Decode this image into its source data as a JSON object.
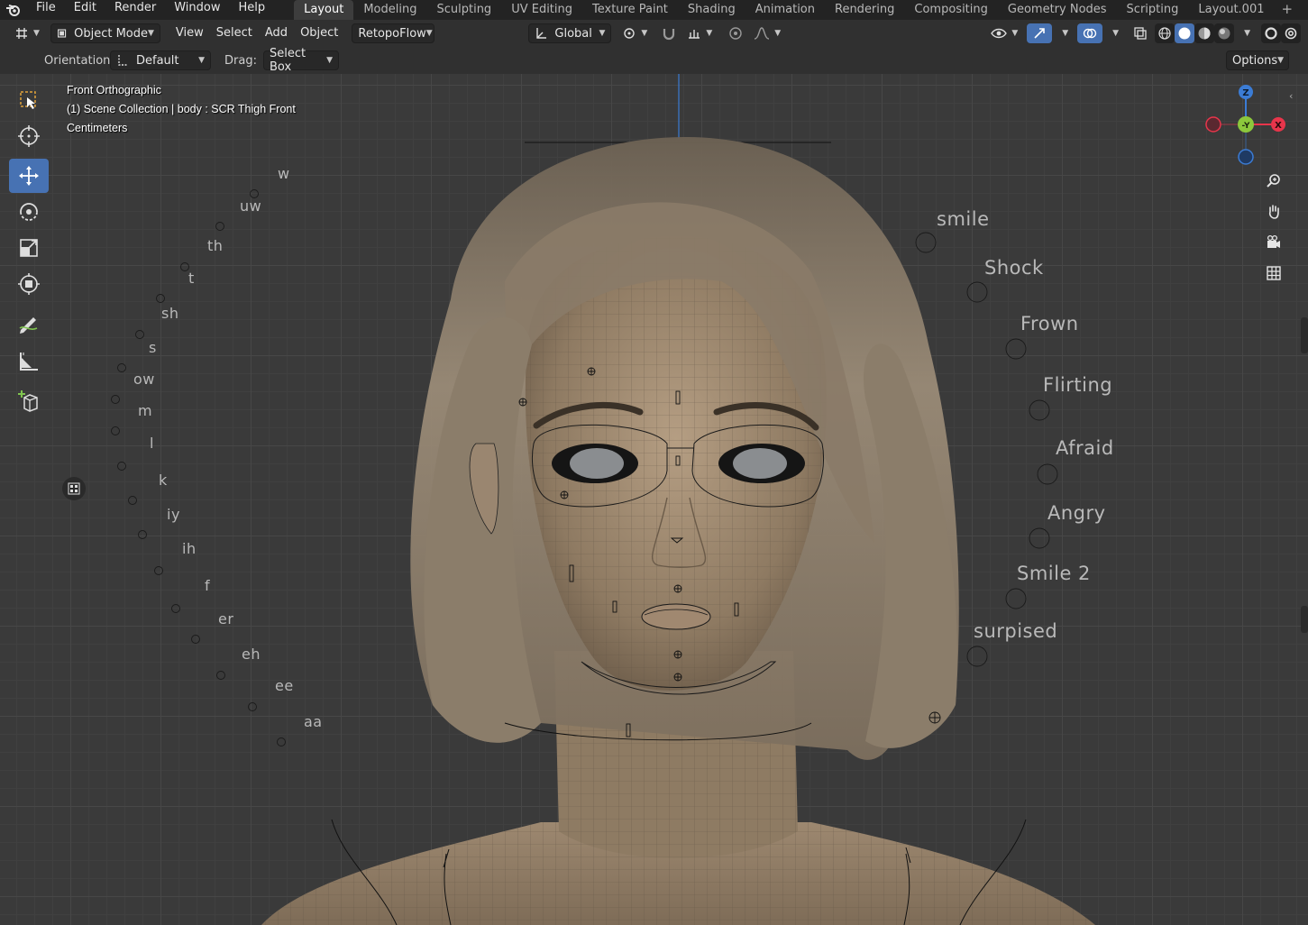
{
  "menu": {
    "items": [
      "File",
      "Edit",
      "Render",
      "Window",
      "Help"
    ]
  },
  "workspaces": {
    "tabs": [
      "Layout",
      "Modeling",
      "Sculpting",
      "UV Editing",
      "Texture Paint",
      "Shading",
      "Animation",
      "Rendering",
      "Compositing",
      "Geometry Nodes",
      "Scripting",
      "Layout.001"
    ],
    "active": "Layout",
    "add_label": "+"
  },
  "header": {
    "mode": "Object Mode",
    "view": "View",
    "select": "Select",
    "add": "Add",
    "object": "Object",
    "addon": "RetopoFlow",
    "transform_orientation": "Global"
  },
  "tool_settings": {
    "orientation_label": "Orientation:",
    "orientation_value": "Default",
    "drag_label": "Drag:",
    "drag_value": "Select Box",
    "options": "Options"
  },
  "viewport": {
    "view_name": "Front Orthographic",
    "collection_info": "(1) Scene Collection | body  : SCR Thigh Front",
    "units": "Centimeters"
  },
  "gizmo": {
    "z": "Z",
    "y": "-Y",
    "x": "X"
  },
  "phonemes": [
    "w",
    "uw",
    "th",
    "t",
    "sh",
    "s",
    "ow",
    "m",
    "l",
    "k",
    "iy",
    "ih",
    "f",
    "er",
    "eh",
    "ee",
    "aa"
  ],
  "expressions": [
    "smile",
    "Shock",
    "Frown",
    "Flirting",
    "Afraid",
    "Angry",
    "Smile 2",
    "surpised"
  ],
  "colors": {
    "accent": "#4772b3",
    "axis_x": "#e8354b",
    "axis_y": "#8cc83c",
    "axis_z": "#3b7cd5"
  }
}
